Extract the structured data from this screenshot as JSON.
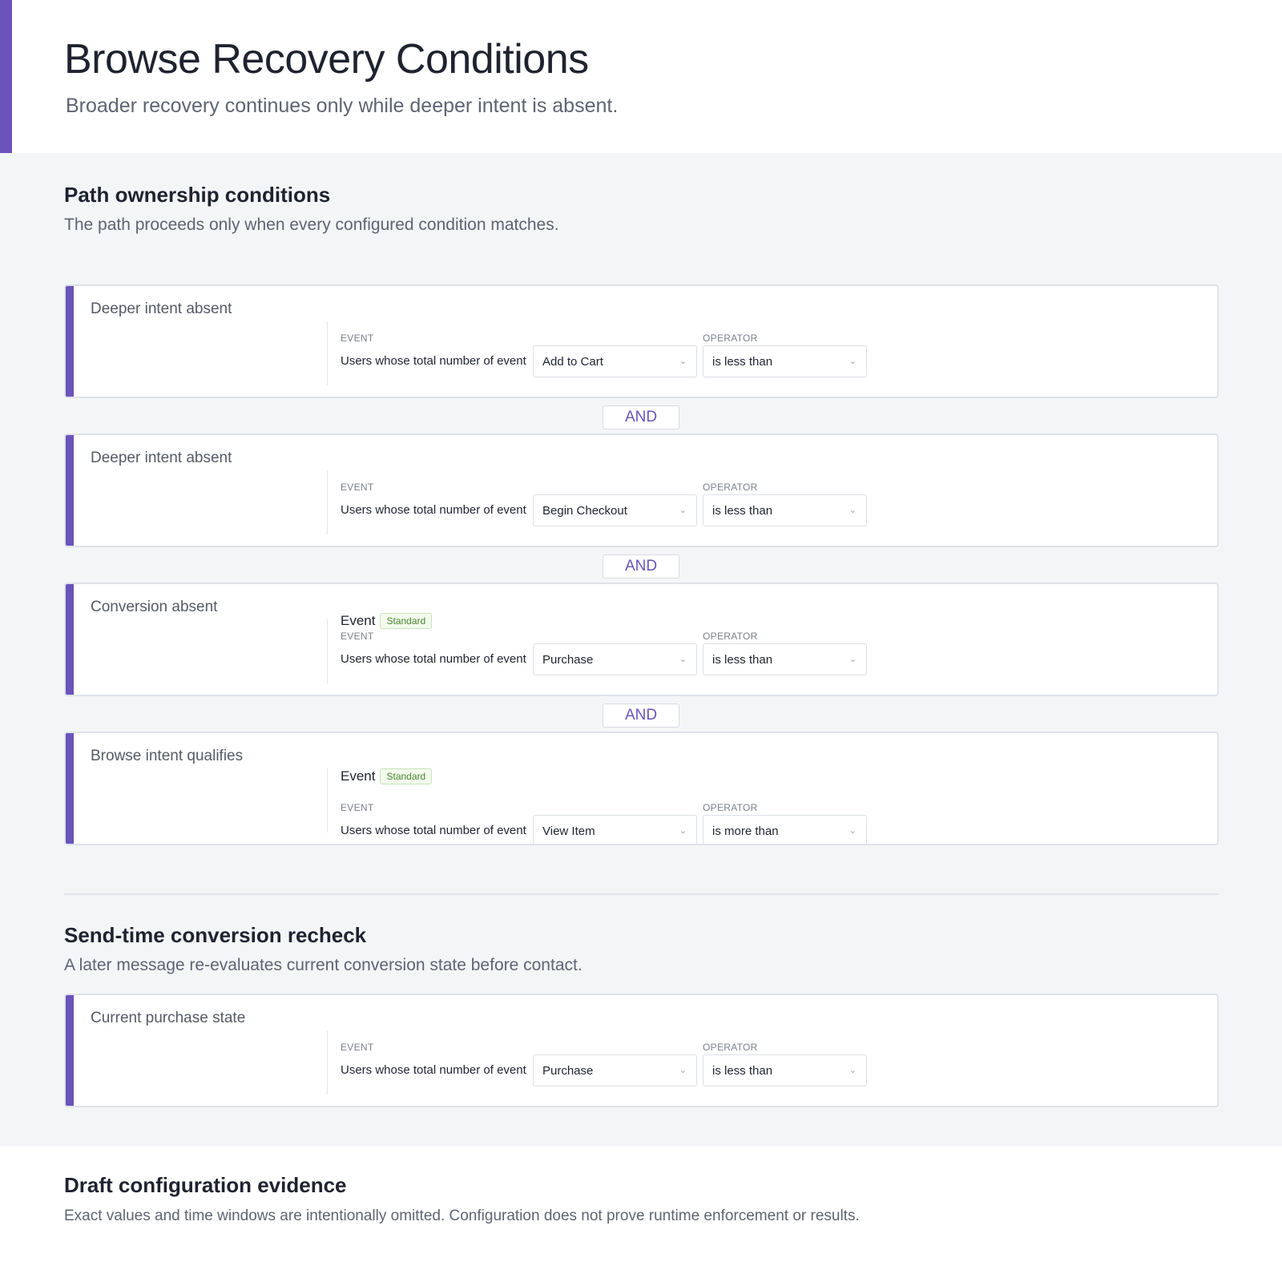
{
  "header": {
    "title": "Browse Recovery Conditions",
    "subtitle": "Broader recovery continues only while deeper intent is absent.",
    "accent_color": "#6a53bb"
  },
  "ownership": {
    "title": "Path ownership conditions",
    "description": "The path proceeds only when every configured condition matches.",
    "connector_label": "AND",
    "conditions": [
      {
        "label": "Deeper intent absent",
        "event_label": "EVENT",
        "operator_label": "OPERATOR",
        "row_text": "Users whose total number of event",
        "event": "Add to Cart",
        "operator": "is less than"
      },
      {
        "label": "Deeper intent absent",
        "event_label": "EVENT",
        "operator_label": "OPERATOR",
        "row_text": "Users whose total number of event",
        "event": "Begin Checkout",
        "operator": "is less than"
      },
      {
        "label": "Conversion absent",
        "peek_word": "Event",
        "peek_badge": "Standard",
        "event_label": "EVENT",
        "operator_label": "OPERATOR",
        "row_text": "Users whose total number of event",
        "event": "Purchase",
        "operator": "is less than"
      },
      {
        "label": "Browse intent qualifies",
        "peek_word": "Event",
        "peek_badge": "Standard",
        "event_label": "EVENT",
        "operator_label": "OPERATOR",
        "row_text": "Users whose total number of event",
        "event": "View Item",
        "operator": "is more than"
      }
    ]
  },
  "recheck": {
    "title": "Send-time conversion recheck",
    "description": "A later message re-evaluates current conversion state before contact.",
    "condition": {
      "label": "Current purchase state",
      "event_label": "EVENT",
      "operator_label": "OPERATOR",
      "row_text": "Users whose total number of event",
      "event": "Purchase",
      "operator": "is less than"
    }
  },
  "evidence": {
    "title": "Draft configuration evidence",
    "description": "Exact values and time windows are intentionally omitted. Configuration does not prove runtime enforcement or results."
  }
}
